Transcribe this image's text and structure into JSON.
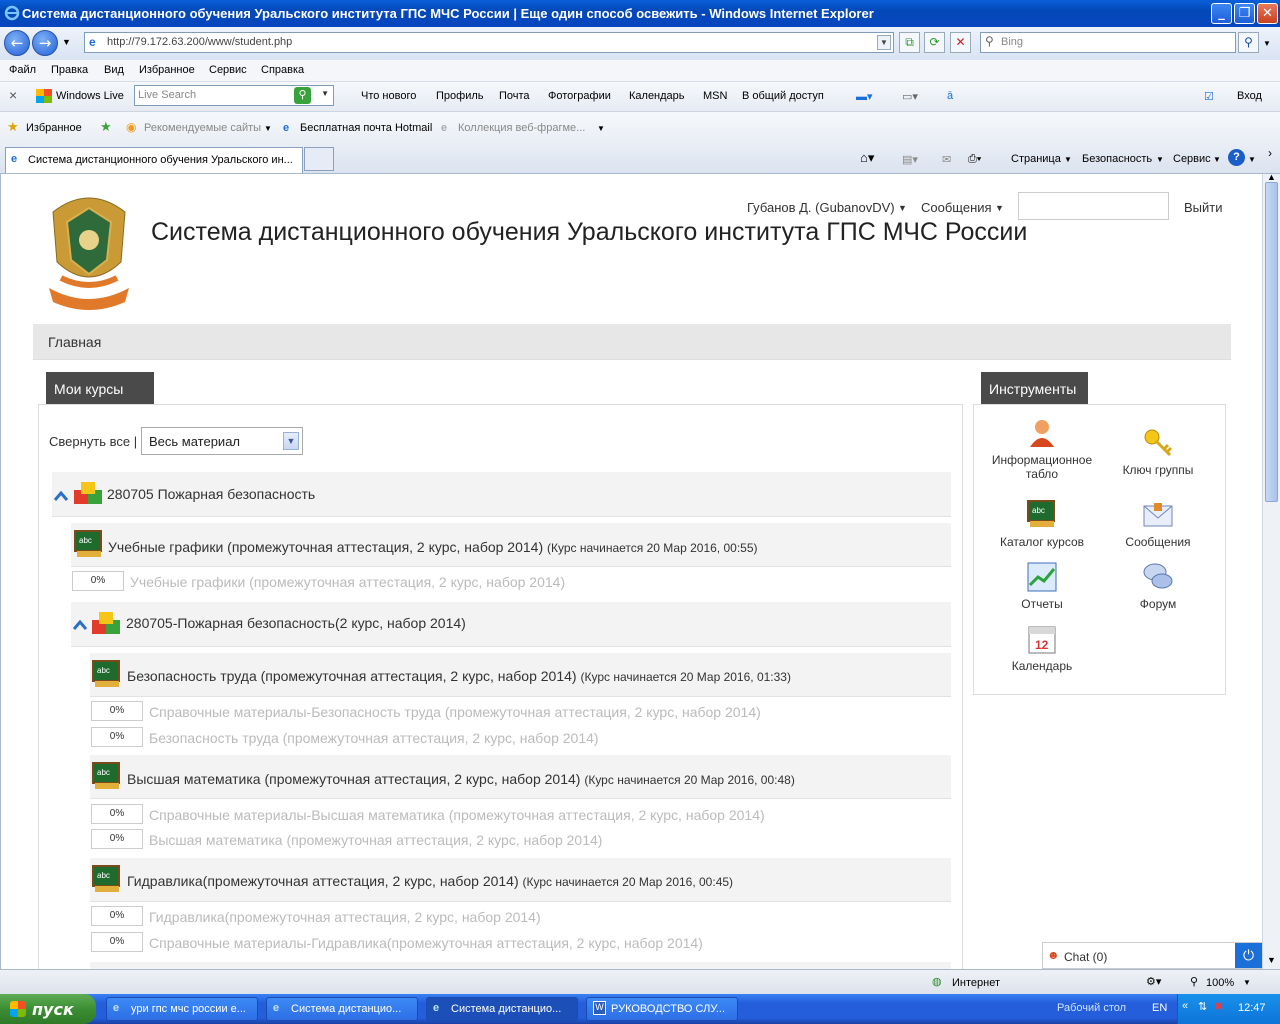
{
  "window": {
    "title": "Система дистанционного обучения Уральского института ГПС МЧС России | Еще один способ освежить  - Windows Internet Explorer"
  },
  "address": {
    "url": "http://79.172.63.200/www/student.php",
    "search_placeholder": "Bing"
  },
  "menu": [
    "Файл",
    "Правка",
    "Вид",
    "Избранное",
    "Сервис",
    "Справка"
  ],
  "live_toolbar": {
    "brand": "Windows Live",
    "search_placeholder": "Live Search",
    "links": [
      "Что нового",
      "Профиль",
      "Почта",
      "Фотографии",
      "Календарь",
      "MSN",
      "В общий доступ"
    ],
    "signin": "Вход"
  },
  "favorites_bar": {
    "favorites": "Избранное",
    "items": [
      "Рекомендуемые сайты",
      "Бесплатная почта Hotmail",
      "Коллекция веб-фрагме..."
    ]
  },
  "tabs": {
    "active": "Система дистанционного обучения Уральского ин...",
    "commands": [
      "Страница",
      "Безопасность",
      "Сервис"
    ]
  },
  "page": {
    "site_title": "Система дистанционного обучения Уральского института ГПС МЧС России",
    "user": "Губанов Д. (GubanovDV)",
    "messages": "Сообщения",
    "logout": "Выйти",
    "nav_home": "Главная",
    "my_courses_title": "Мои курсы",
    "collapse_all": "Свернуть все |",
    "filter_value": "Весь материал",
    "tools_title": "Инструменты",
    "courses": [
      {
        "kind": "group",
        "title": "280705 Пожарная безопасность"
      },
      {
        "kind": "course",
        "title": "Учебные графики (промежуточная аттестация, 2 курс, набор 2014)",
        "start": "(Курс начинается 20 Мар 2016, 00:55)",
        "materials": [
          {
            "progress": "0%",
            "title": "Учебные графики (промежуточная аттестация, 2 курс, набор 2014)"
          }
        ]
      },
      {
        "kind": "group",
        "title": "280705-Пожарная безопасность(2 курс, набор 2014)"
      },
      {
        "kind": "course",
        "title": "Безопасность труда (промежуточная аттестация, 2 курс, набор 2014)",
        "start": "(Курс начинается 20 Мар 2016, 01:33)",
        "materials": [
          {
            "progress": "0%",
            "title": "Справочные материалы-Безопасность труда (промежуточная аттестация, 2 курс, набор 2014)"
          },
          {
            "progress": "0%",
            "title": "Безопасность труда (промежуточная аттестация, 2 курс, набор 2014)"
          }
        ]
      },
      {
        "kind": "course",
        "title": "Высшая математика (промежуточная аттестация, 2 курс, набор 2014)",
        "start": "(Курс начинается 20 Мар 2016, 00:48)",
        "materials": [
          {
            "progress": "0%",
            "title": "Справочные материалы-Высшая математика (промежуточная аттестация, 2 курс, набор 2014)"
          },
          {
            "progress": "0%",
            "title": "Высшая математика (промежуточная аттестация, 2 курс, набор 2014)"
          }
        ]
      },
      {
        "kind": "course",
        "title": "Гидравлика(промежуточная аттестация, 2 курс, набор 2014)",
        "start": "(Курс начинается 20 Мар 2016, 00:45)",
        "materials": [
          {
            "progress": "0%",
            "title": "Гидравлика(промежуточная аттестация, 2 курс, набор 2014)"
          },
          {
            "progress": "0%",
            "title": "Справочные материалы-Гидравлика(промежуточная аттестация, 2 курс, набор 2014)"
          }
        ]
      }
    ],
    "tools": [
      {
        "label": "Информационное табло",
        "icon": "person-icon"
      },
      {
        "label": "Ключ группы",
        "icon": "key-icon"
      },
      {
        "label": "Каталог курсов",
        "icon": "course-catalog-icon"
      },
      {
        "label": "Сообщения",
        "icon": "envelope-icon"
      },
      {
        "label": "Отчеты",
        "icon": "chart-icon"
      },
      {
        "label": "Форум",
        "icon": "forum-icon"
      },
      {
        "label": "Календарь",
        "icon": "calendar-icon"
      }
    ],
    "calendar_day": "12",
    "chat": "Chat (0)"
  },
  "status": {
    "zone": "Интернет",
    "zoom": "100%"
  },
  "taskbar": {
    "start": "пуск",
    "tasks": [
      "ури гпс мчс россии е...",
      "Система дистанцио...",
      "Система дистанцио...",
      "РУКОВОДСТВО СЛУ..."
    ],
    "desktop": "Рабочий стол",
    "lang": "EN",
    "time": "12:47"
  }
}
